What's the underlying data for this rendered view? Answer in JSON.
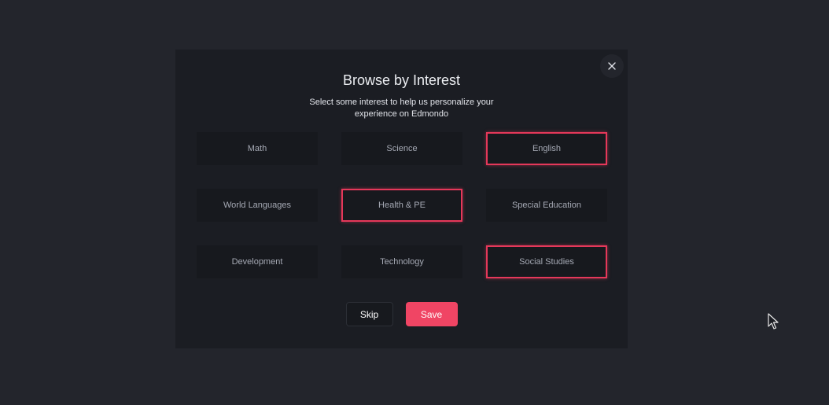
{
  "modal": {
    "title": "Browse by Interest",
    "subtitle": "Select some interest to help us personalize your experience on Edmondo",
    "close_icon": "close-icon",
    "interests": [
      {
        "label": "Math",
        "selected": false
      },
      {
        "label": "Science",
        "selected": false
      },
      {
        "label": "English",
        "selected": true
      },
      {
        "label": "World Languages",
        "selected": false
      },
      {
        "label": "Health & PE",
        "selected": true
      },
      {
        "label": "Special Education",
        "selected": false
      },
      {
        "label": "Development",
        "selected": false
      },
      {
        "label": "Technology",
        "selected": false
      },
      {
        "label": "Social Studies",
        "selected": true
      }
    ],
    "skip_label": "Skip",
    "save_label": "Save"
  },
  "colors": {
    "page_background": "#23252c",
    "modal_background": "#1b1d23",
    "tile_background": "#17191e",
    "selected_border": "#e5385a",
    "save_button": "#f04564"
  }
}
